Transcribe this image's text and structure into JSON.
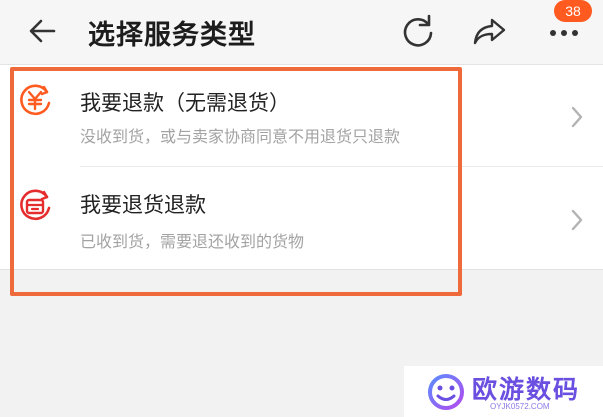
{
  "header": {
    "title": "选择服务类型",
    "back_icon": "arrow-left-icon",
    "refresh_icon": "refresh-icon",
    "share_icon": "share-icon",
    "more_icon": "more-dots-icon",
    "badge_count": "38"
  },
  "options": [
    {
      "title": "我要退款（无需退货）",
      "subtitle": "没收到货，或与卖家协商同意不用退货只退款",
      "icon": "yuan-refund-icon",
      "icon_color": "#ff5a1f"
    },
    {
      "title": "我要退货退款",
      "subtitle": "已收到货，需要退还收到的货物",
      "icon": "return-goods-icon",
      "icon_color": "#e52d2d"
    }
  ],
  "highlight_color": "#ef6a3a",
  "watermark": {
    "title": "欧游数码",
    "url": "OYJK0572.COM"
  }
}
